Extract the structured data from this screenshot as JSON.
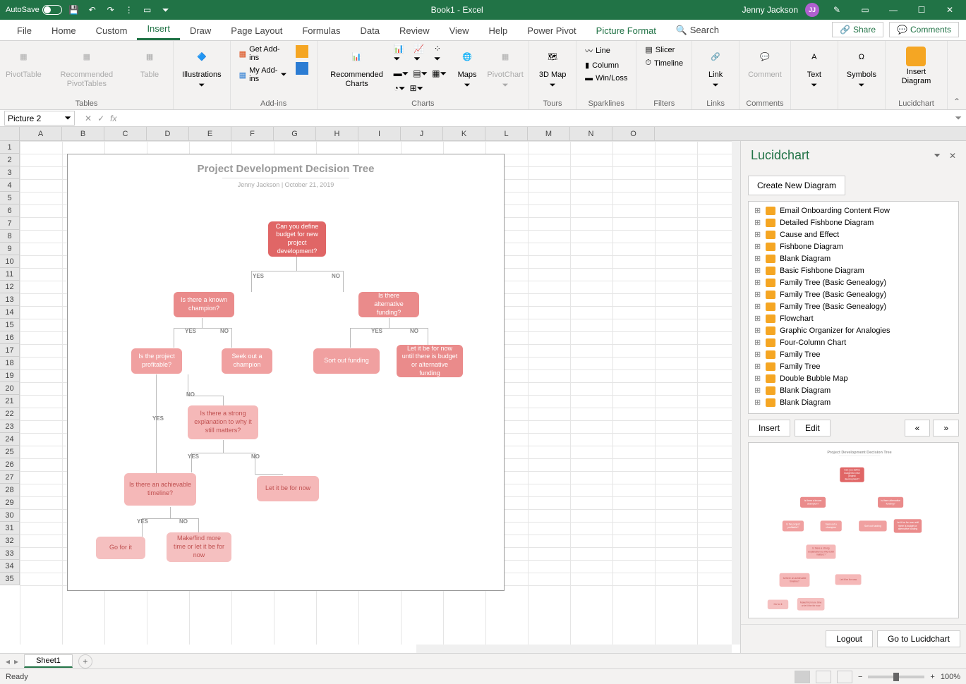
{
  "titlebar": {
    "autosave": "AutoSave",
    "title": "Book1 - Excel",
    "user": "Jenny Jackson",
    "user_initials": "JJ"
  },
  "tabs": {
    "file": "File",
    "home": "Home",
    "custom": "Custom",
    "insert": "Insert",
    "draw": "Draw",
    "page_layout": "Page Layout",
    "formulas": "Formulas",
    "data": "Data",
    "review": "Review",
    "view": "View",
    "help": "Help",
    "power_pivot": "Power Pivot",
    "picture_format": "Picture Format",
    "search": "Search",
    "share": "Share",
    "comments": "Comments"
  },
  "ribbon": {
    "tables": {
      "label": "Tables",
      "pivot": "PivotTable",
      "rec_pivot": "Recommended PivotTables",
      "table": "Table"
    },
    "illustrations": {
      "label": "Illustrations",
      "btn": "Illustrations"
    },
    "addins": {
      "label": "Add-ins",
      "get": "Get Add-ins",
      "my": "My Add-ins"
    },
    "charts": {
      "label": "Charts",
      "rec": "Recommended Charts",
      "maps": "Maps",
      "pivot_chart": "PivotChart"
    },
    "tours": {
      "label": "Tours",
      "map3d": "3D Map"
    },
    "sparklines": {
      "label": "Sparklines",
      "line": "Line",
      "column": "Column",
      "winloss": "Win/Loss"
    },
    "filters": {
      "label": "Filters",
      "slicer": "Slicer",
      "timeline": "Timeline"
    },
    "links": {
      "label": "Links",
      "link": "Link"
    },
    "comments": {
      "label": "Comments",
      "comment": "Comment"
    },
    "text": {
      "label": "Text",
      "btn": "Text"
    },
    "symbols": {
      "label": "Symbols",
      "btn": "Symbols"
    },
    "lucid": {
      "label": "Lucidchart",
      "btn": "Insert Diagram"
    }
  },
  "namebox": "Picture 2",
  "columns": [
    "A",
    "B",
    "C",
    "D",
    "E",
    "F",
    "G",
    "H",
    "I",
    "J",
    "K",
    "L",
    "M",
    "N",
    "O"
  ],
  "flowchart": {
    "title": "Project Development Decision Tree",
    "subtitle": "Jenny Jackson  |  October 21, 2019",
    "nodes": {
      "root": "Can you define budget for new project development?",
      "champion": "Is there a known champion?",
      "alt_funding": "Is there alternative funding?",
      "profitable": "Is the project profitable?",
      "seek": "Seek out a champion",
      "sort": "Sort out funding",
      "letbe_budget": "Let it be for now until there is budget or alternative funding",
      "explanation": "Is there a strong explanation to why it still matters?",
      "timeline": "Is there an achievable timeline?",
      "letbe": "Let it be for now",
      "goforit": "Go for it",
      "maketime": "Make/find more time or let it be for now"
    },
    "labels": {
      "yes": "YES",
      "no": "NO"
    }
  },
  "panel": {
    "title": "Lucidchart",
    "create": "Create New Diagram",
    "items": [
      "Email Onboarding Content Flow",
      "Detailed Fishbone Diagram",
      "Cause and Effect",
      "Fishbone Diagram",
      "Blank Diagram",
      "Basic Fishbone Diagram",
      "Family Tree (Basic Genealogy)",
      "Family Tree (Basic Genealogy)",
      "Family Tree (Basic Genealogy)",
      "Flowchart",
      "Graphic Organizer for Analogies",
      "Four-Column Chart",
      "Family Tree",
      "Family Tree",
      "Double Bubble Map",
      "Blank Diagram",
      "Blank Diagram"
    ],
    "insert": "Insert",
    "edit": "Edit",
    "logout": "Logout",
    "goto": "Go to Lucidchart",
    "preview_title": "Project Development Decision Tree"
  },
  "sheet_tab": "Sheet1",
  "status": {
    "ready": "Ready",
    "zoom": "100%"
  }
}
